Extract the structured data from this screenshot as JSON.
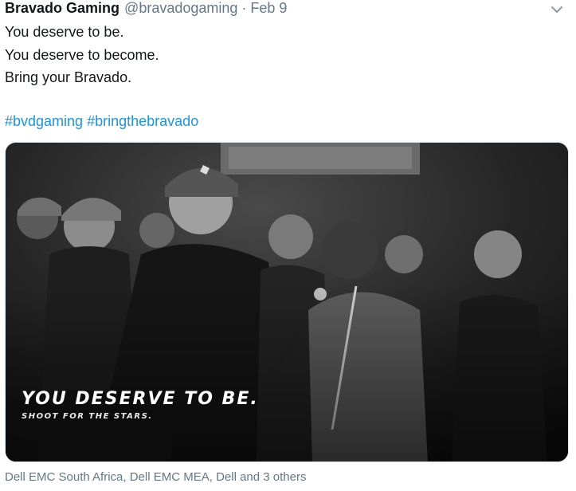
{
  "tweet": {
    "author_name": "Bravado Gaming",
    "author_handle": "@bravadogaming",
    "separator": "·",
    "date": "Feb 9",
    "lines": [
      "You deserve to be.",
      "You deserve to become.",
      "Bring your Bravado."
    ],
    "hashtags": [
      "#bvdgaming",
      "#bringthebravado"
    ],
    "menu_icon": "chevron-down-icon"
  },
  "media": {
    "overlay_title": "YOU DESERVE TO BE.",
    "overlay_subtitle": "SHOOT FOR THE STARS."
  },
  "tagged": {
    "text": "Dell EMC South Africa, Dell EMC MEA, Dell and 3 others"
  },
  "colors": {
    "link": "#1b95e0",
    "muted": "#657786",
    "text": "#14171a"
  }
}
